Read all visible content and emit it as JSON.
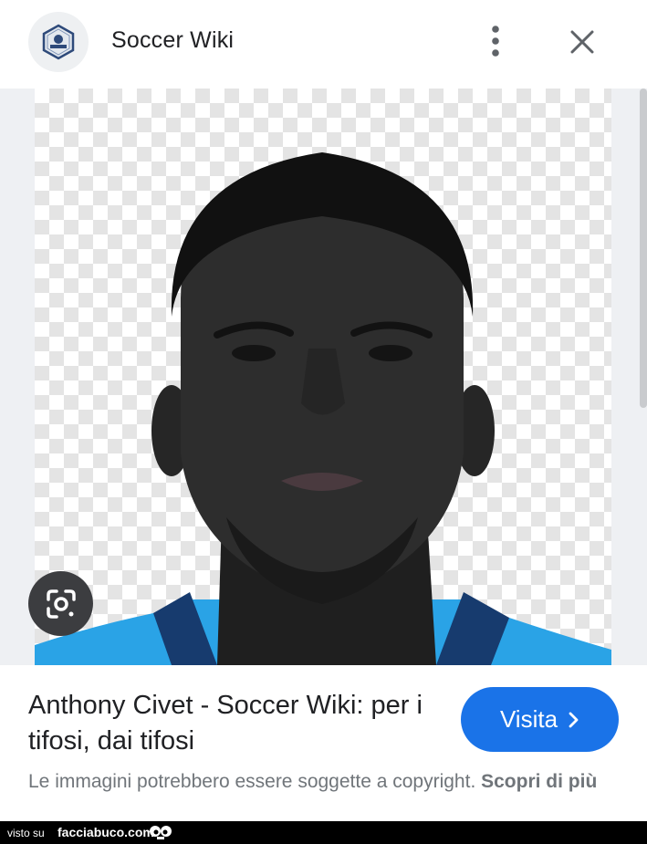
{
  "header": {
    "site_name": "Soccer Wiki",
    "logo_icon": "soccer-wiki-logo",
    "more_icon": "vertical-dots-icon",
    "close_icon": "close-icon"
  },
  "viewer": {
    "image_subject": "player-portrait",
    "lens_icon": "google-lens-icon"
  },
  "info": {
    "title": "Anthony Civet - Soccer Wiki: per i tifosi, dai tifosi",
    "visit_label": "Visita",
    "visit_icon": "chevron-right-icon",
    "copyright_text": "Le immagini potrebbero essere soggette a copyright.",
    "learn_more": "Scopri di più"
  },
  "footer": {
    "seen_on": "visto su",
    "brand": "facciabuco.com"
  },
  "colors": {
    "accent": "#1a73e8",
    "text_primary": "#202124",
    "text_secondary": "#70757a",
    "viewer_bg": "#eef0f3",
    "jersey": "#2aa3e6"
  }
}
